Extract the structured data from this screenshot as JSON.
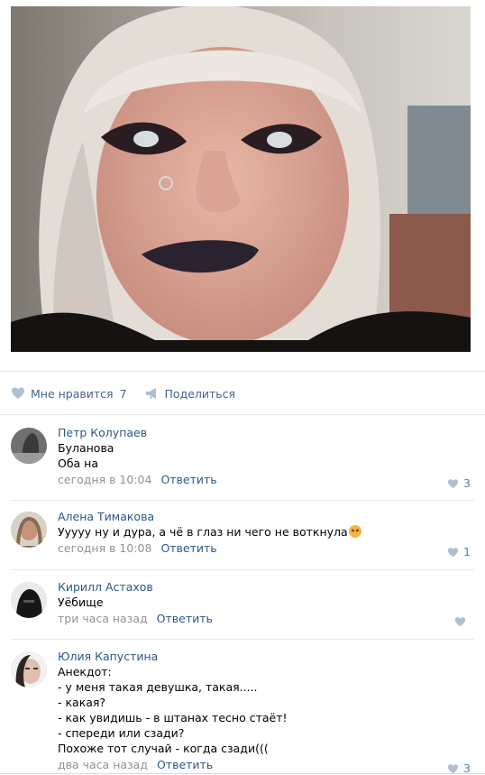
{
  "post": {
    "like_label": "Мне нравится",
    "like_count": "7",
    "share_label": "Поделиться"
  },
  "comments": [
    {
      "author": "Петр Колупаев",
      "lines": [
        "Буланова",
        "Оба на"
      ],
      "time": "сегодня в 10:04",
      "reply": "Ответить",
      "likes": "3"
    },
    {
      "author": "Алена Тимакова",
      "lines": [
        "Ууууу ну и дура, а чё в глаз ни чего не воткнула"
      ],
      "time": "сегодня в 10:08",
      "reply": "Ответить",
      "likes": "1"
    },
    {
      "author": "Кирилл Астахов",
      "lines": [
        "Уёбище"
      ],
      "time": "три часа назад",
      "reply": "Ответить",
      "likes": ""
    },
    {
      "author": "Юлия Капустина",
      "lines": [
        "Анекдот:",
        "- у меня такая девушка, такая.....",
        "- какая?",
        "- как увидишь - в штанах тесно стаёт!",
        "- спереди или сзади?",
        "Похоже тот случай - когда сзади((("
      ],
      "time": "два часа назад",
      "reply": "Ответить",
      "likes": "3"
    }
  ],
  "colors": {
    "link": "#2a5885",
    "action": "#42648b",
    "meta": "#939393",
    "like_icon": "#5181b8",
    "divider": "#e7e8ec"
  }
}
